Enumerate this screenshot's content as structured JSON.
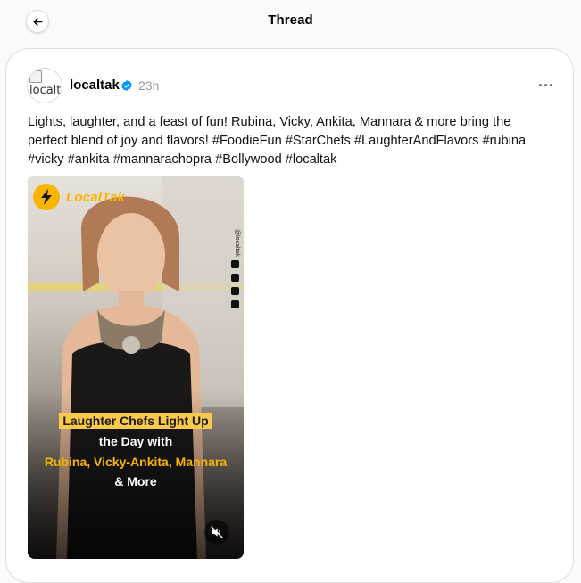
{
  "header": {
    "title": "Thread",
    "back_icon": "arrow-left-icon"
  },
  "post": {
    "avatar_alt": "localt",
    "username": "localtak",
    "verified_icon": "verified-badge-icon",
    "verified_color": "#0095f6",
    "time": "23h",
    "more_icon": "more-horizontal-icon",
    "text": "Lights, laughter, and a feast of fun! Rubina, Vicky, Ankita, Mannara & more bring the perfect blend of joy and flavors! #FoodieFun #StarChefs #LaughterAndFlavors #rubina #vicky #ankita #mannarachopra #Bollywood #localtak",
    "media": {
      "logo_text": "LocalTak",
      "side_handle": "@localtak",
      "caption_line1": "Laughter Chefs Light Up",
      "caption_line2": "the Day with",
      "caption_line3": "Rubina, Vicky-Ankita, Mannara",
      "caption_line4": "& More",
      "mute_icon": "muted-speaker-icon",
      "accent_color": "#f7b500"
    }
  }
}
